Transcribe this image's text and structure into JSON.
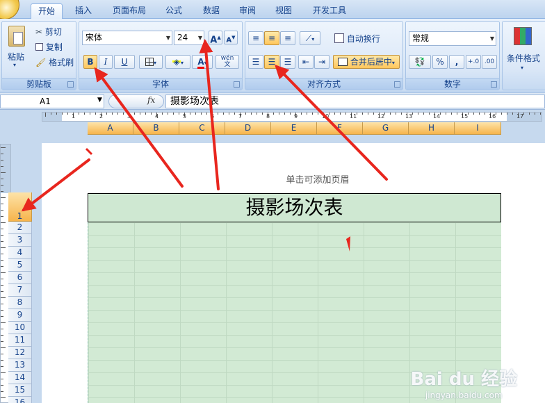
{
  "ribbon": {
    "tabs": [
      "开始",
      "插入",
      "页面布局",
      "公式",
      "数据",
      "审阅",
      "视图",
      "开发工具"
    ],
    "active_tab": "开始",
    "clipboard": {
      "paste": "粘贴",
      "cut": "剪切",
      "copy": "复制",
      "format_painter": "格式刷",
      "label": "剪贴板"
    },
    "font": {
      "name": "宋体",
      "size": "24",
      "bold": "B",
      "italic": "I",
      "underline": "U",
      "grow": "A",
      "shrink": "A",
      "font_color": "A",
      "phonetic": "wén",
      "phonetic_char": "文",
      "label": "字体"
    },
    "alignment": {
      "wrap": "自动换行",
      "merge": "合并后居中",
      "label": "对齐方式"
    },
    "number": {
      "format": "常规",
      "percent": "%",
      "comma": ",",
      "inc_decimal": "+.0",
      "dec_decimal": ".00",
      "label": "数字"
    },
    "styles": {
      "conditional": "条件格式"
    }
  },
  "formula_bar": {
    "cell_ref": "A1",
    "fx": "fx",
    "content": "摄影场次表"
  },
  "sheet": {
    "columns": [
      "A",
      "B",
      "C",
      "D",
      "E",
      "F",
      "G",
      "H",
      "I"
    ],
    "rows": [
      "1",
      "2",
      "3",
      "4",
      "5",
      "6",
      "7",
      "8",
      "9",
      "10",
      "11",
      "12",
      "13",
      "14",
      "15",
      "16"
    ],
    "header_hint": "单击可添加页眉",
    "title": "摄影场次表"
  },
  "ruler": {
    "numbers": [
      "1",
      "2",
      "3",
      "4",
      "5",
      "6",
      "7",
      "8",
      "9",
      "10",
      "11",
      "12",
      "13",
      "14",
      "15",
      "16",
      "17"
    ]
  },
  "watermark": {
    "logo": "Bai du 经验",
    "url": "jingyan.baidu.com"
  },
  "colors": {
    "accent_highlight": "#ffc65c",
    "cell_fill": "#cfe8d2",
    "annotation_arrow": "#e8261e"
  }
}
